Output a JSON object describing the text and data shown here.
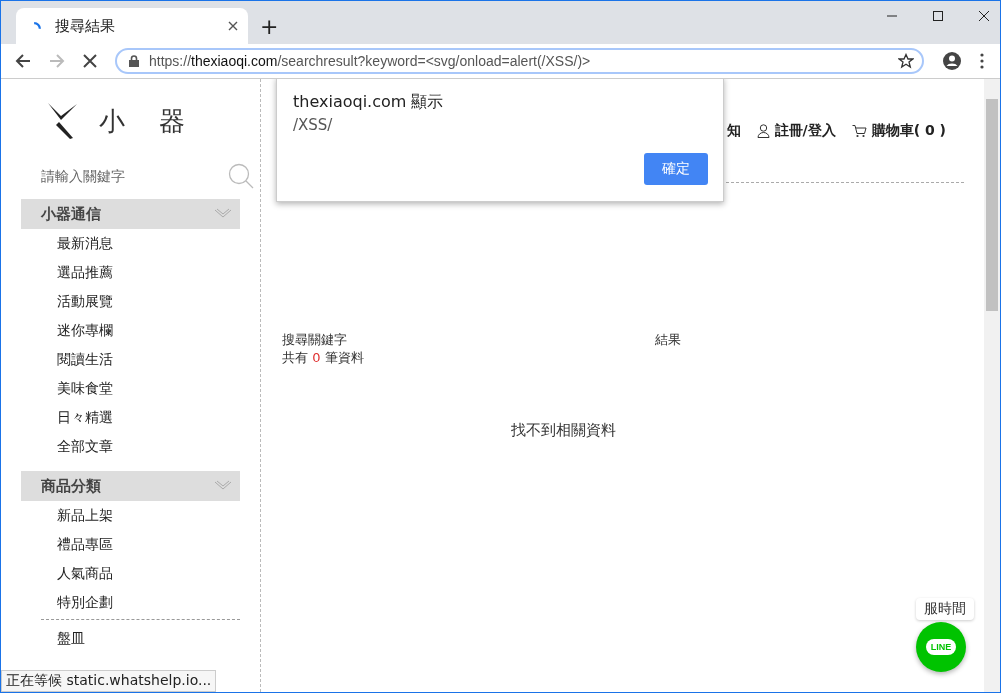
{
  "browser": {
    "tab_title": "搜尋結果",
    "new_tab": "+",
    "url_host": "thexiaoqi.com",
    "url_scheme": "https://",
    "url_path": "/searchresult?keyword=<svg/onload=alert(/XSS/)>",
    "loading": true
  },
  "sidebar": {
    "logo_text": [
      "小",
      "器"
    ],
    "search": {
      "placeholder": "請輸入關鍵字"
    },
    "sections": [
      {
        "title": "小器通信",
        "expanded": true,
        "items": [
          "最新消息",
          "選品推薦",
          "活動展覽",
          "迷你專欄",
          "閱讀生活",
          "美味食堂",
          "日々精選",
          "全部文章"
        ]
      },
      {
        "title": "商品分類",
        "expanded": true,
        "items": [
          "新品上架",
          "禮品專區",
          "人氣商品",
          "特別企劃"
        ],
        "more_items": [
          "盤皿"
        ]
      }
    ]
  },
  "header_nav": [
    {
      "kind": "text",
      "label": "知"
    },
    {
      "kind": "user",
      "label": "註冊/登入"
    },
    {
      "kind": "cart",
      "label": "購物車",
      "count": "( 0 )"
    }
  ],
  "search_result": {
    "keyword_label": "搜尋關鍵字",
    "result_label": "結果",
    "count_prefix": "共有",
    "count": "0",
    "count_suffix": "筆資料",
    "empty_message": "找不到相關資料"
  },
  "dialog": {
    "title": "thexiaoqi.com 顯示",
    "message": "/XSS/",
    "button": "確定"
  },
  "chat_widget": {
    "tooltip": "服時間",
    "badge": "LINE"
  },
  "status_bar": "正在等候 static.whatshelp.io..."
}
